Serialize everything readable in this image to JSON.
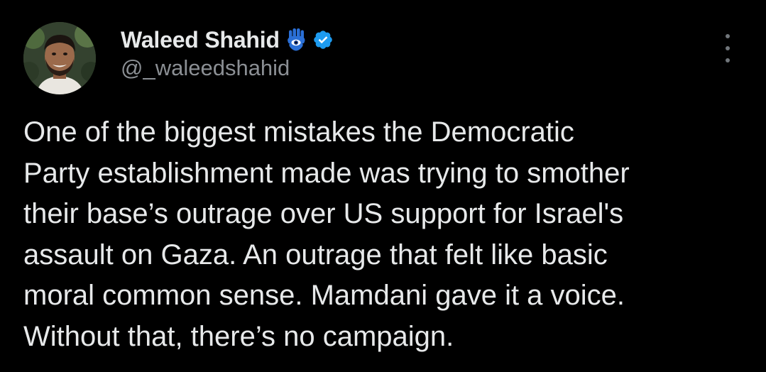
{
  "author": {
    "display_name": "Waleed Shahid",
    "handle": "@_waleedshahid",
    "hamsa_emoji_icon": "hamsa-hand-icon",
    "verified_icon": "verified-badge-icon"
  },
  "actions": {
    "more_icon": "more-options-icon"
  },
  "tweet": {
    "lines": [
      "One of the biggest mistakes the Democratic",
      "Party establishment made was trying to smother",
      "their base’s outrage over US support for Israel's",
      "assault on Gaza. An outrage that felt like basic",
      "moral common sense. Mamdani gave it a voice.",
      "Without that, there’s no campaign."
    ]
  },
  "colors": {
    "background": "#000000",
    "text_primary": "#e7e9ea",
    "text_secondary": "#8b8f94",
    "verified_blue": "#1d9bf0"
  }
}
